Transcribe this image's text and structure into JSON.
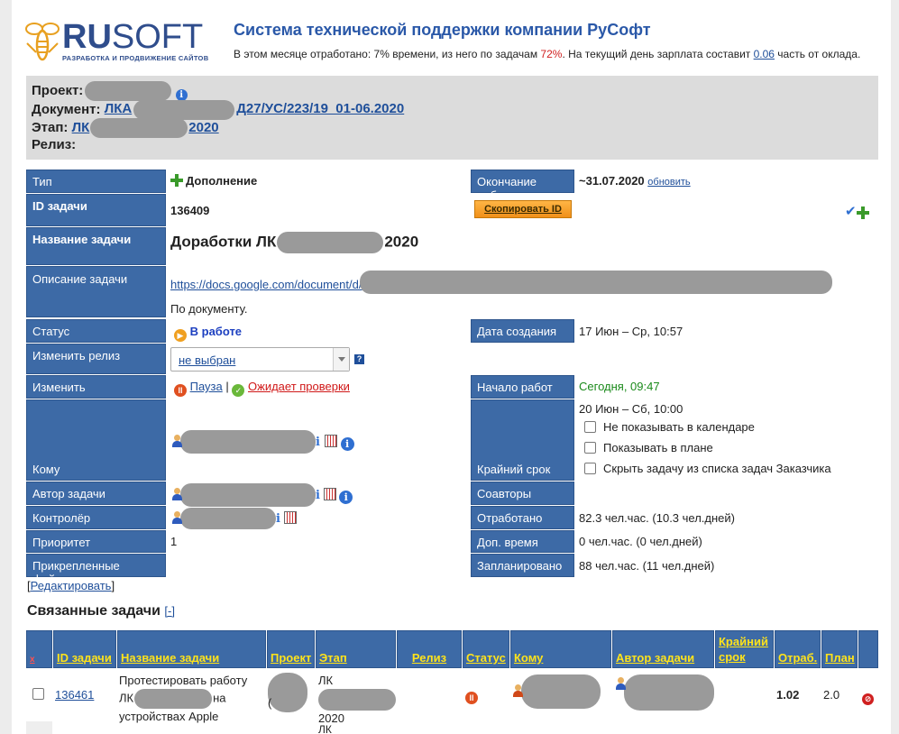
{
  "header": {
    "logo_word_bold": "RU",
    "logo_word_rest": "SOFT",
    "logo_sub": "РАЗРАБОТКА И ПРОДВИЖЕНИЕ САЙТОВ",
    "title": "Система технической поддержки компании РуСофт",
    "stat_prefix": "В этом месяце отработано: 7% времени, из него по задачам ",
    "stat_pct": "72%",
    "stat_mid": ". На текущий день зарплата составит ",
    "stat_value": "0.06",
    "stat_suffix": " часть от оклада."
  },
  "project": {
    "project_label": "Проект:",
    "document_label": "Документ:",
    "document_link_start": "ЛКА",
    "document_link_end": "Д27/УС/223/19_01-06.2020",
    "stage_label": "Этап:",
    "stage_link_start": "ЛК",
    "stage_link_end": "2020",
    "release_label": "Релиз:"
  },
  "fields": {
    "type_label": "Тип",
    "type_value": "Дополнение",
    "end_label": "Окончание работ",
    "end_value": "~31.07.2020",
    "end_update": "обновить",
    "id_label": "ID задачи",
    "id_value": "136409",
    "copy_id": "Скопировать ID",
    "name_label": "Название задачи",
    "name_start": "Доработки ЛК",
    "name_end": "2020",
    "desc_label": "Описание задачи",
    "desc_link": "https://docs.google.com/document/d/",
    "desc_text": "По документу.",
    "status_label": "Статус",
    "status_value": "В работе",
    "created_label": "Дата создания",
    "created_value": "17 Июн – Ср, 10:57",
    "release_label": "Изменить релиз",
    "release_value": "не выбран",
    "help": "?",
    "change_label": "Изменить",
    "pause": "Пауза",
    "separator": "|",
    "await": "Ожидает проверки",
    "start_label": "Начало работ",
    "start_value": "Сегодня, 09:47",
    "to_label": "Кому",
    "deadline_label": "Крайний срок",
    "deadline_value": "20 Июн – Сб, 10:00",
    "opt_calendar": "Не показывать в календаре",
    "opt_plan": "Показывать в плане",
    "opt_hide": "Скрыть задачу из списка задач Заказчика",
    "author_label": "Автор задачи",
    "coauthors_label": "Соавторы",
    "controller_label": "Контролёр",
    "worked_label": "Отработано",
    "worked_value": "82.3 чел.час. (10.3 чел.дней)",
    "priority_label": "Приоритет",
    "priority_value": "1",
    "extra_label": "Доп. время",
    "extra_value": "0 чел.час. (0 чел.дней)",
    "files_label": "Прикрепленные файлы",
    "planned_label": "Запланировано",
    "planned_value": "88 чел.час. (11 чел.дней)",
    "edit_open": "[",
    "edit": "Редактировать",
    "edit_close": "]",
    "info_glyph": "i"
  },
  "related": {
    "title": "Связанные задачи",
    "toggle": "[-]",
    "columns": [
      "x",
      "ID задачи",
      "Название задачи",
      "Проект",
      "Этап",
      "Релиз",
      "Статус",
      "Кому",
      "Автор задачи",
      "Крайний срок",
      "Отраб.",
      "План"
    ],
    "rows": [
      {
        "id": "136461",
        "name_l1": "Протестировать работу",
        "name_l2_start": "ЛК",
        "name_l2_end": "на",
        "name_l3": "устройствах Apple",
        "project_tail": "(",
        "stage_l1": "ЛК",
        "stage_l3": "2020",
        "worked": "1.02",
        "plan": "2.0"
      }
    ],
    "next_row_stage": "ЛК"
  },
  "colors": {
    "label_bg": "#3d6aa6",
    "header_link": "#ffe31a",
    "accent_title": "#2a58a8"
  }
}
